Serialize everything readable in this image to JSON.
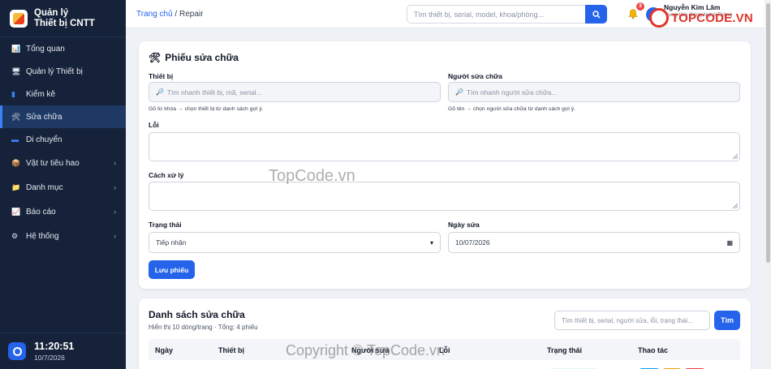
{
  "brand": {
    "line1": "Quản lý",
    "line2": "Thiết bị CNTT"
  },
  "nav": [
    {
      "icon": "📊",
      "label": "Tổng quan"
    },
    {
      "icon": "🖥",
      "label": "Quản lý Thiết bị"
    },
    {
      "icon": "▮",
      "label": "Kiểm kê"
    },
    {
      "icon": "🛠",
      "label": "Sửa chữa"
    },
    {
      "icon": "▬",
      "label": "Di chuyển"
    },
    {
      "icon": "📦",
      "label": "Vật tư tiêu hao",
      "chevron": "›"
    },
    {
      "icon": "📁",
      "label": "Danh mục",
      "chevron": "›"
    },
    {
      "icon": "📈",
      "label": "Báo cáo",
      "chevron": "›"
    },
    {
      "icon": "⚙",
      "label": "Hệ thống",
      "chevron": "›"
    }
  ],
  "clock": {
    "time": "11:20:51",
    "date": "10/7/2026"
  },
  "topbar": {
    "breadcrumb_home": "Trang chủ",
    "breadcrumb_sep": " / ",
    "breadcrumb_current": "Repair",
    "search_placeholder": "Tìm thiết bị, serial, model, khoa/phòng...",
    "notif_count": "3",
    "user_name": "Nguyễn Kim Lâm",
    "user_org": "Trung tâm Công Nghệ Thông Tin"
  },
  "repair_form": {
    "title": "Phiếu sửa chữa",
    "device_label": "Thiết bị",
    "device_placeholder": "Tìm nhanh thiết bị, mã, serial...",
    "device_hint": "Gõ từ khóa → chọn thiết bị từ danh sách gợi ý.",
    "repairer_label": "Người sửa chữa",
    "repairer_placeholder": "Tìm nhanh người sửa chữa...",
    "repairer_hint": "Gõ tên → chọn người sửa chữa từ danh sách gợi ý.",
    "error_label": "Lỗi",
    "fix_label": "Cách xử lý",
    "status_label": "Trạng thái",
    "status_value": "Tiếp nhận",
    "date_label": "Ngày sửa",
    "date_value": "10/07/2026",
    "save_label": "Lưu phiếu"
  },
  "repair_list": {
    "title": "Danh sách sửa chữa",
    "subtitle": "Hiển thị 10 dòng/trang · Tổng: 4 phiếu",
    "search_placeholder": "Tìm thiết bị, serial, người sửa, lỗi, trạng thái...",
    "find_label": "Tìm",
    "columns": [
      "Ngày",
      "Thiết bị",
      "Người sửa",
      "Lỗi",
      "Trạng thái",
      "Thao tác"
    ]
  },
  "watermarks": {
    "center": "TopCode.vn",
    "bottom": "Copyright © TopCode.vn",
    "logo": "TOPCODE.VN"
  },
  "colors": {
    "sidebar": "#16223a",
    "accent": "#2563eb",
    "danger": "#ef4444"
  }
}
